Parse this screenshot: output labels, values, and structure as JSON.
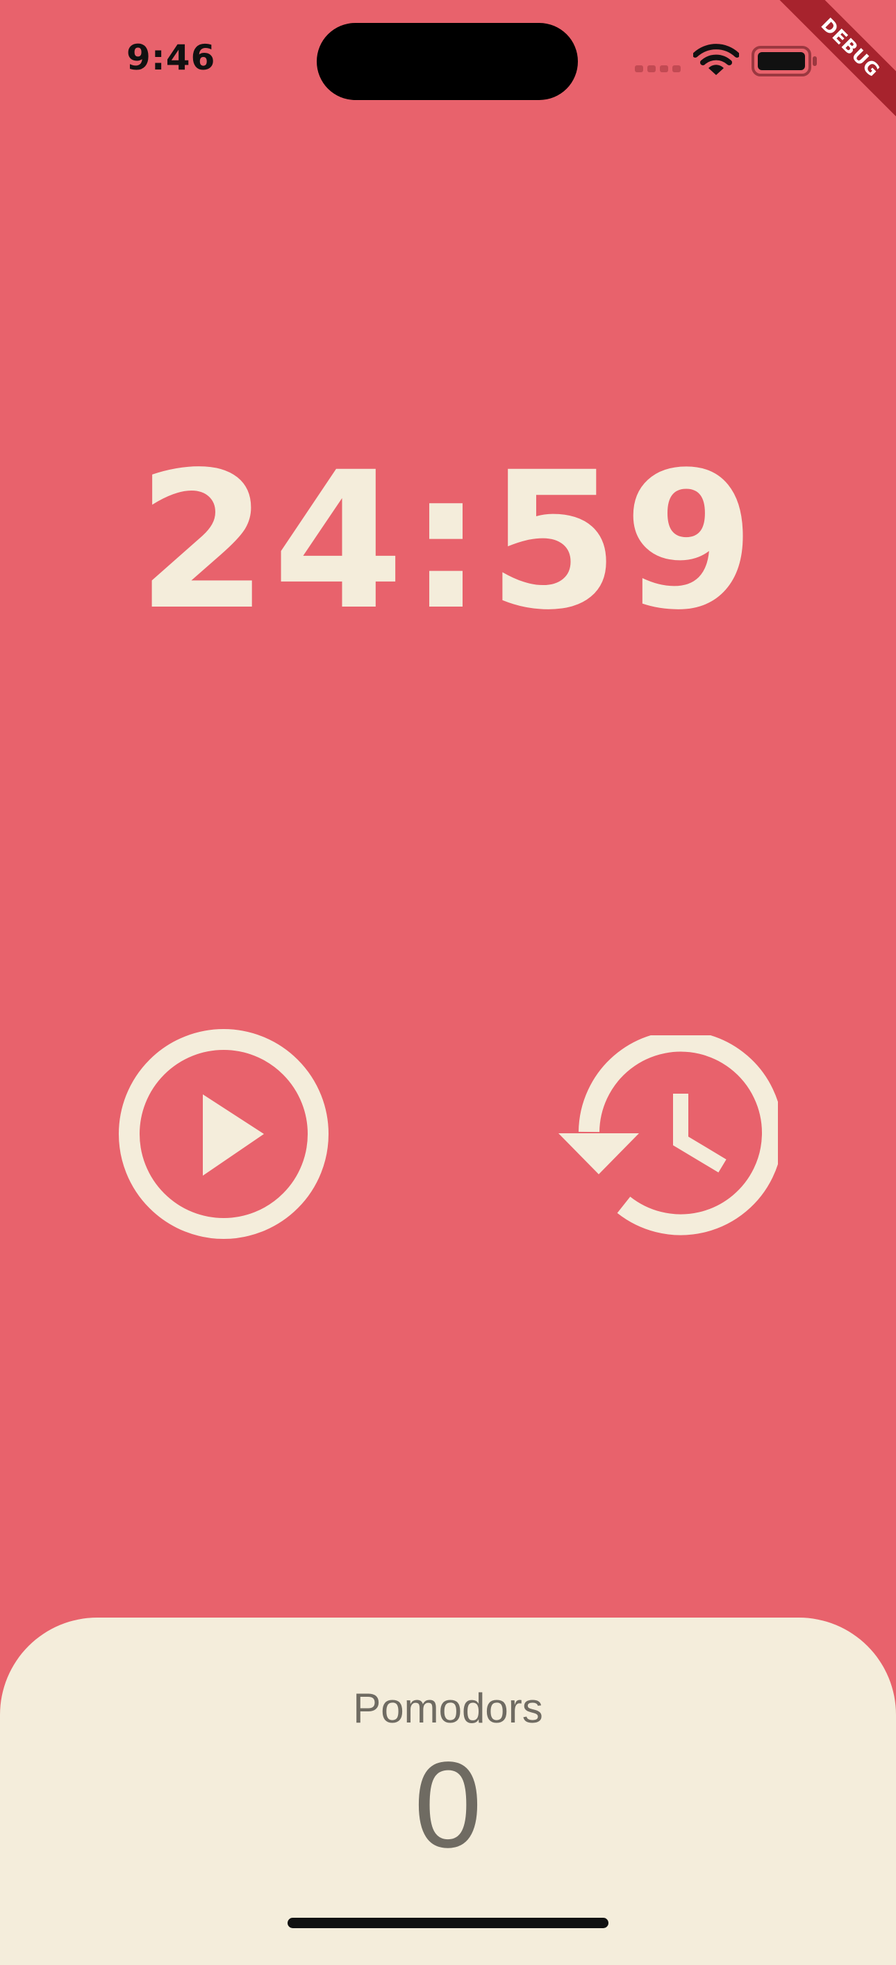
{
  "status_bar": {
    "time": "9:46",
    "icons": [
      "signal-icon",
      "wifi-icon",
      "battery-icon"
    ]
  },
  "debug_banner": "DEBUG",
  "timer": {
    "display": "24:59"
  },
  "controls": {
    "play_icon": "play-circle-icon",
    "reset_icon": "restore-history-icon"
  },
  "stats": {
    "label": "Pomodors",
    "value": "0"
  },
  "colors": {
    "background": "#E8626C",
    "foreground": "#F4EDDB",
    "panel_text": "#6F6B62",
    "debug_banner": "#A7232D"
  }
}
